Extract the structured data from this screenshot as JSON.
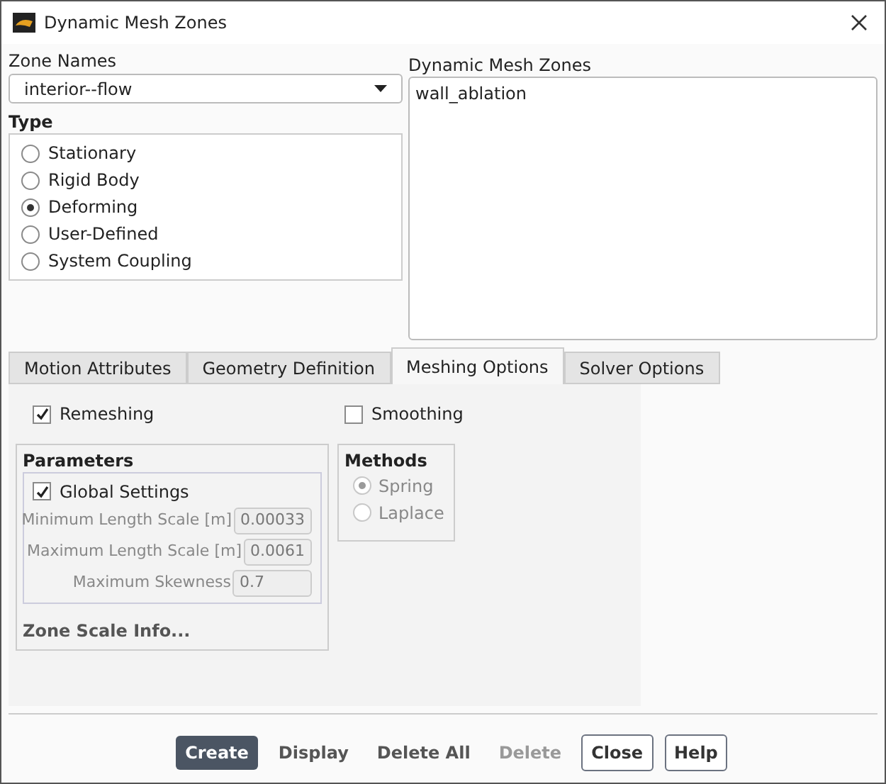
{
  "window": {
    "title": "Dynamic Mesh Zones"
  },
  "zone_names": {
    "label": "Zone Names",
    "value": "interior--flow"
  },
  "type": {
    "label": "Type",
    "options": [
      {
        "label": "Stationary",
        "selected": false
      },
      {
        "label": "Rigid Body",
        "selected": false
      },
      {
        "label": "Deforming",
        "selected": true
      },
      {
        "label": "User-Defined",
        "selected": false
      },
      {
        "label": "System Coupling",
        "selected": false
      }
    ]
  },
  "dynamic_mesh_zones": {
    "label": "Dynamic Mesh Zones",
    "items": [
      {
        "label": "wall_ablation",
        "selected": false
      }
    ]
  },
  "tabs": [
    {
      "label": "Motion Attributes",
      "selected": false
    },
    {
      "label": "Geometry Definition",
      "selected": false
    },
    {
      "label": "Meshing Options",
      "selected": true
    },
    {
      "label": "Solver Options",
      "selected": false
    }
  ],
  "remeshing": {
    "label": "Remeshing",
    "checked": true
  },
  "smoothing": {
    "label": "Smoothing",
    "checked": false
  },
  "parameters": {
    "title": "Parameters",
    "global_settings": {
      "label": "Global Settings",
      "checked": true
    },
    "fields": [
      {
        "label": "Minimum Length Scale [m]",
        "value": "0.00033",
        "disabled": true
      },
      {
        "label": "Maximum Length Scale [m]",
        "value": "0.0061",
        "disabled": true
      },
      {
        "label": "Maximum Skewness",
        "value": "0.7",
        "disabled": true
      }
    ],
    "link": "Zone Scale Info..."
  },
  "methods": {
    "title": "Methods",
    "disabled": true,
    "options": [
      {
        "label": "Spring",
        "selected": true
      },
      {
        "label": "Laplace",
        "selected": false
      }
    ]
  },
  "buttons": [
    {
      "label": "Create",
      "kind": "primary"
    },
    {
      "label": "Display",
      "kind": "flat"
    },
    {
      "label": "Delete All",
      "kind": "flat"
    },
    {
      "label": "Delete",
      "kind": "disabled"
    },
    {
      "label": "Close",
      "kind": "outline"
    },
    {
      "label": "Help",
      "kind": "outline"
    }
  ]
}
